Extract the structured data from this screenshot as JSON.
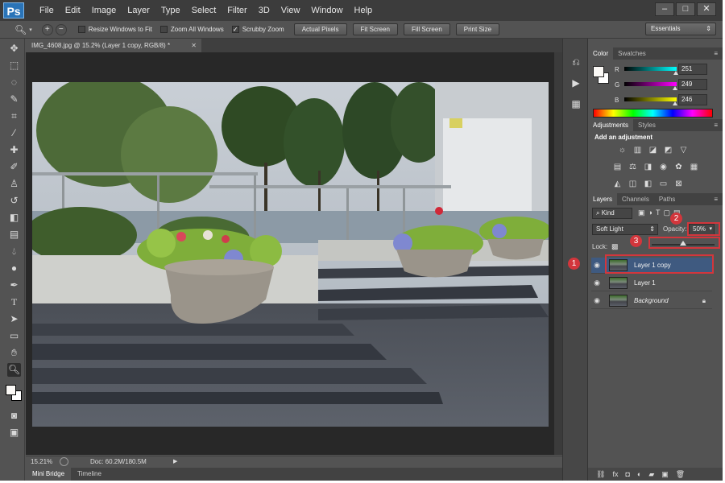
{
  "app": {
    "logo": "Ps"
  },
  "menu": [
    "File",
    "Edit",
    "Image",
    "Layer",
    "Type",
    "Select",
    "Filter",
    "3D",
    "View",
    "Window",
    "Help"
  ],
  "window_buttons": {
    "minimize": "–",
    "maximize": "□",
    "close": "✕"
  },
  "options_bar": {
    "resize_windows": "Resize Windows to Fit",
    "zoom_all_windows": "Zoom All Windows",
    "scrubby_zoom": "Scrubby Zoom",
    "scrubby_checked": "✓",
    "actual_pixels": "Actual Pixels",
    "fit_screen": "Fit Screen",
    "fill_screen": "Fill Screen",
    "print_size": "Print Size",
    "workspace": "Essentials"
  },
  "document": {
    "tab_title": "IMG_4608.jpg @ 15.2% (Layer 1 copy, RGB/8) *",
    "zoom": "15.21%",
    "doc_size": "Doc: 60.2M/180.5M"
  },
  "bottom_tabs": [
    "Mini Bridge",
    "Timeline"
  ],
  "color_panel": {
    "tabs": [
      "Color",
      "Swatches"
    ],
    "channels": [
      {
        "label": "R",
        "value": "251",
        "fraction": 0.984,
        "from": "#000000",
        "to": "#00ffff"
      },
      {
        "label": "G",
        "value": "249",
        "fraction": 0.976,
        "from": "#000000",
        "to": "#ff00ff"
      },
      {
        "label": "B",
        "value": "246",
        "fraction": 0.965,
        "from": "#000000",
        "to": "#ffff00"
      }
    ],
    "foreground": "#fbf9f6"
  },
  "adjustments_panel": {
    "tabs": [
      "Adjustments",
      "Styles"
    ],
    "heading": "Add an adjustment"
  },
  "layers_panel": {
    "tabs": [
      "Layers",
      "Channels",
      "Paths"
    ],
    "filter": "Kind",
    "blend_mode": "Soft Light",
    "opacity_label": "Opacity:",
    "opacity_value": "50%",
    "opacity_fraction": 0.5,
    "lock_label": "Lock:",
    "layers": [
      {
        "name": "Layer 1 copy",
        "selected": true
      },
      {
        "name": "Layer 1",
        "selected": false
      },
      {
        "name": "Background",
        "selected": false,
        "locked": true
      }
    ]
  },
  "callouts": [
    "1",
    "2",
    "3"
  ],
  "accent_color": "#d3363c",
  "selection_color": "#3f5a80"
}
